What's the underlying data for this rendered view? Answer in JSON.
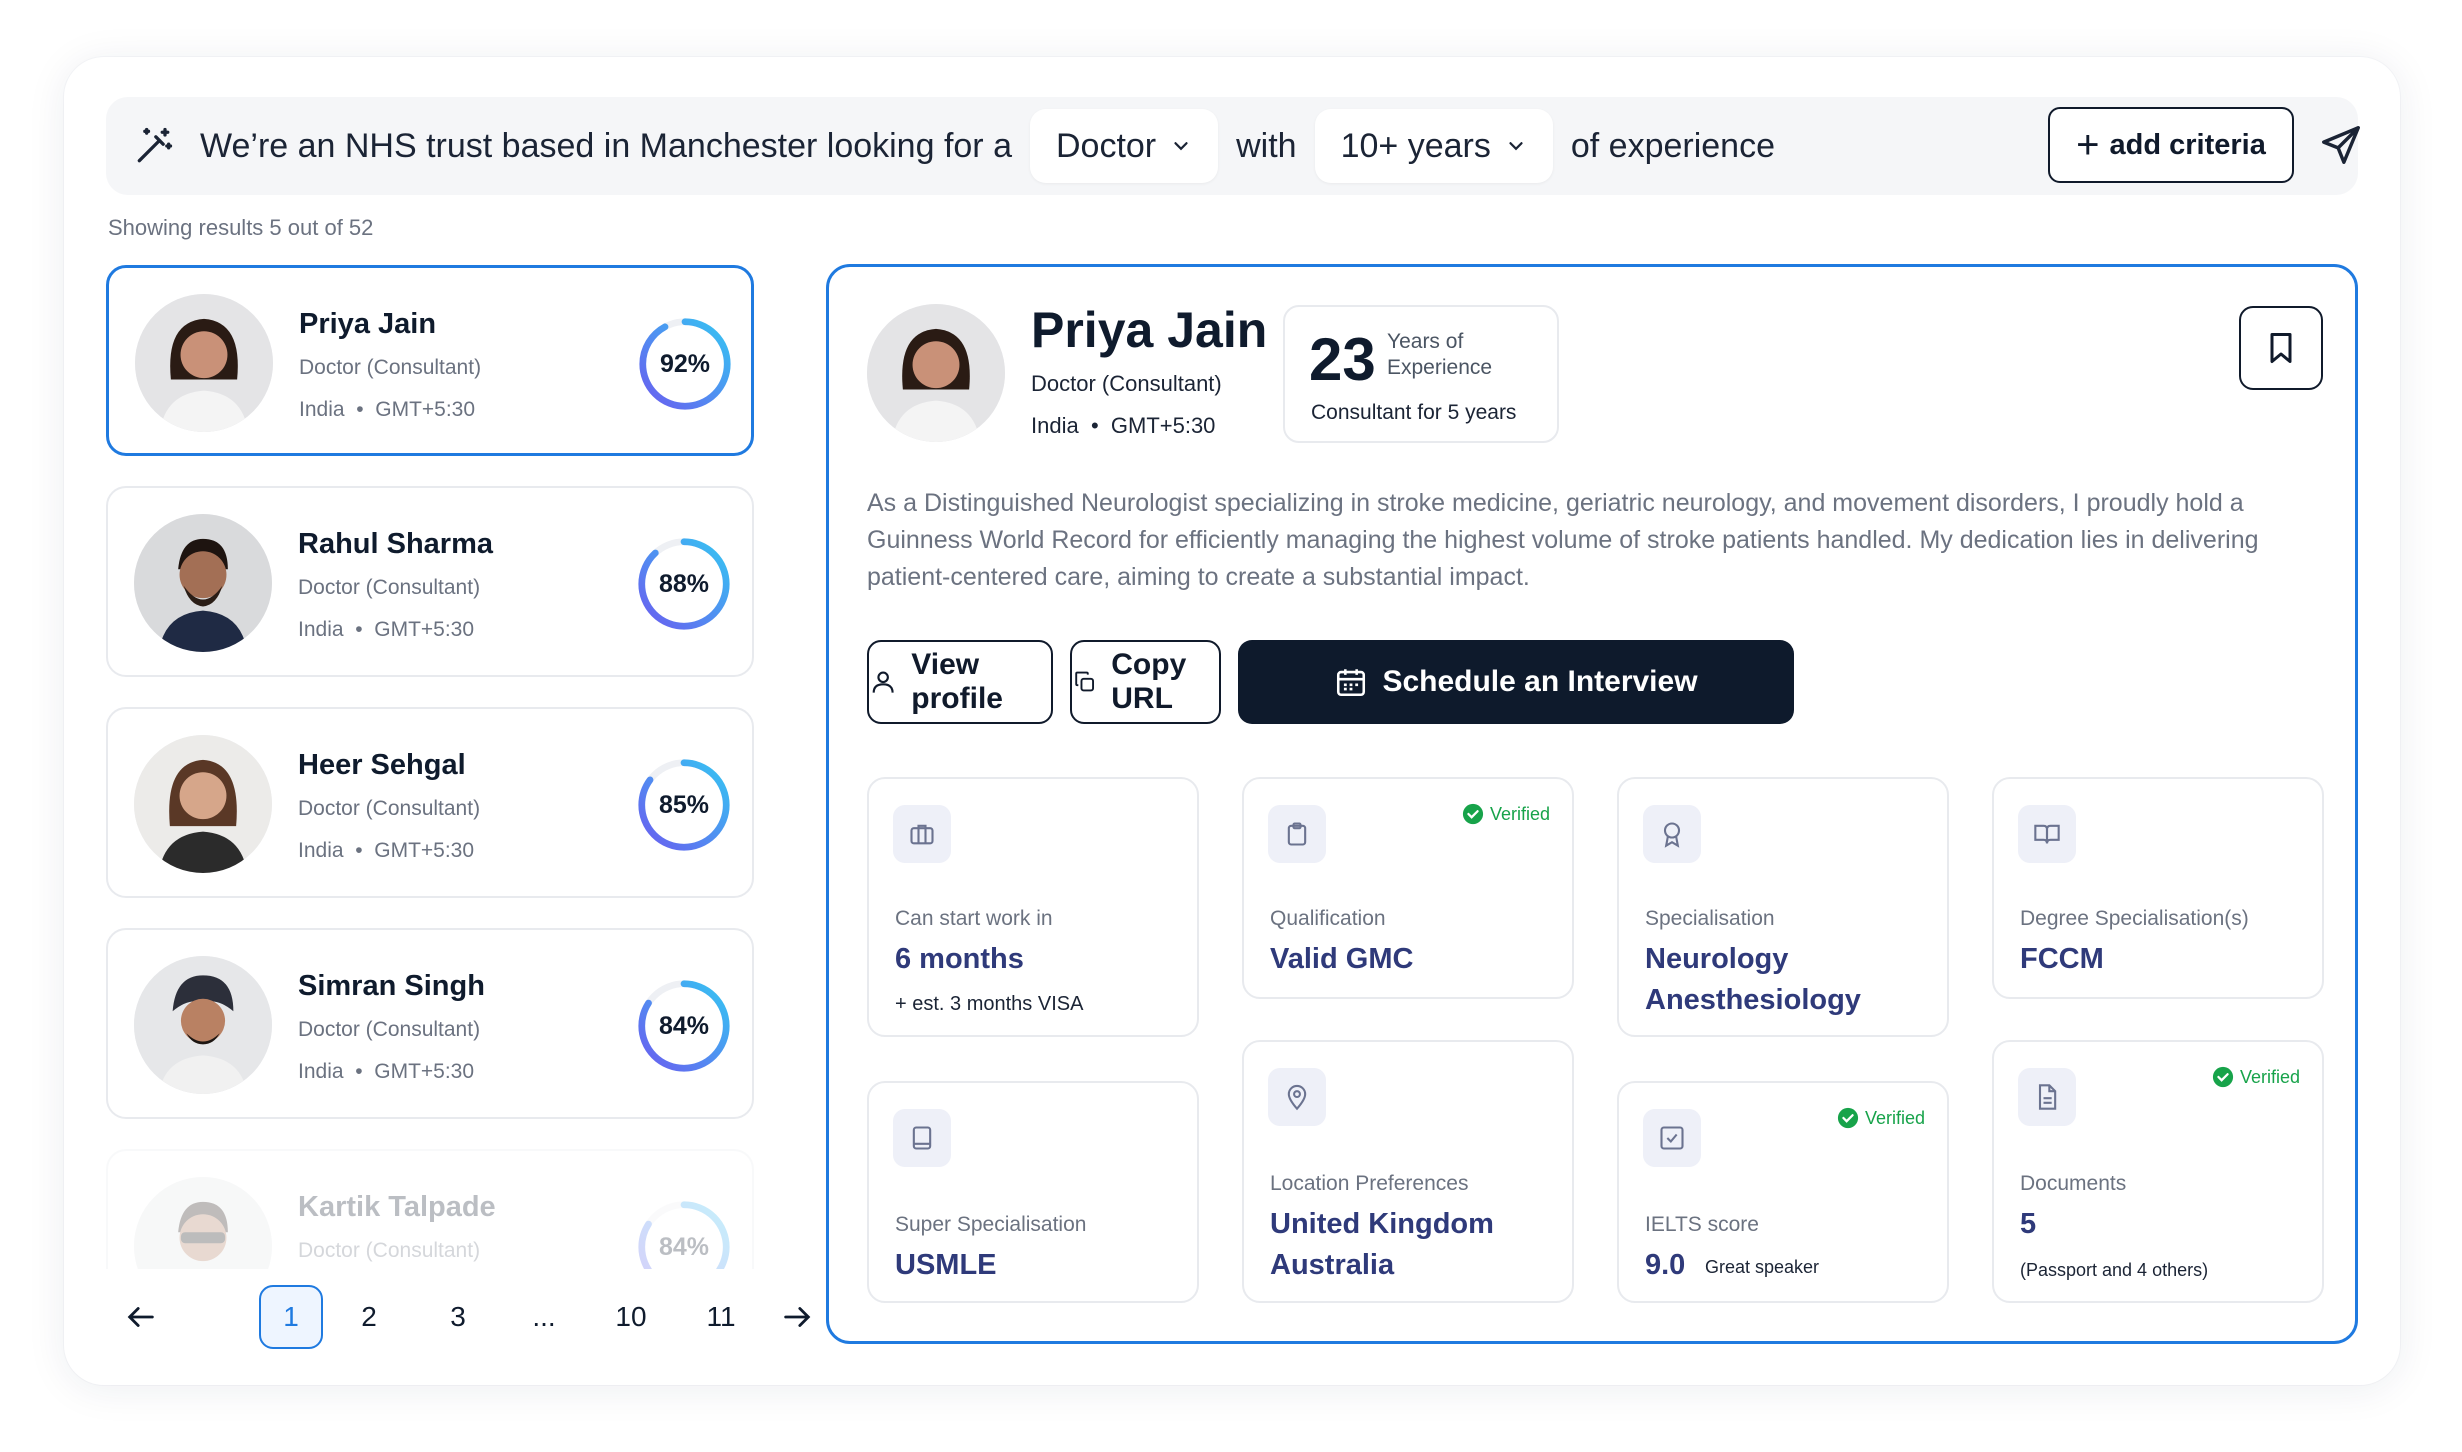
{
  "search": {
    "prefix": "We’re an NHS trust based in Manchester looking for a",
    "role_value": "Doctor",
    "connector": "with",
    "experience_value": "10+ years",
    "suffix": "of experience",
    "add_criteria_label": "add criteria"
  },
  "results": {
    "showing_text": "Showing results 5 out of 52"
  },
  "candidates": [
    {
      "name": "Priya Jain",
      "role": "Doctor (Consultant)",
      "country": "India",
      "tz": "GMT+5:30",
      "match": "92%",
      "match_value": 92,
      "avatar": "woman-avatar"
    },
    {
      "name": "Rahul Sharma",
      "role": "Doctor (Consultant)",
      "country": "India",
      "tz": "GMT+5:30",
      "match": "88%",
      "match_value": 88,
      "avatar": "man-avatar"
    },
    {
      "name": "Heer Sehgal",
      "role": "Doctor (Consultant)",
      "country": "India",
      "tz": "GMT+5:30",
      "match": "85%",
      "match_value": 85,
      "avatar": "woman-avatar"
    },
    {
      "name": "Simran Singh",
      "role": "Doctor (Consultant)",
      "country": "India",
      "tz": "GMT+5:30",
      "match": "84%",
      "match_value": 84,
      "avatar": "man-turban-avatar"
    },
    {
      "name": "Kartik Talpade",
      "role": "Doctor (Consultant)",
      "country": "India",
      "tz": "GMT+5:30",
      "match": "84%",
      "match_value": 84,
      "avatar": "man-sunglasses-avatar"
    }
  ],
  "pagination": {
    "pages": [
      "1",
      "2",
      "3",
      "...",
      "10",
      "11"
    ],
    "current": "1"
  },
  "detail": {
    "name": "Priya Jain",
    "role": "Doctor (Consultant)",
    "country": "India",
    "tz": "GMT+5:30",
    "years": "23",
    "years_label": "Years of Experience",
    "consultant_note": "Consultant for 5 years",
    "bio": "As a Distinguished Neurologist specializing in stroke medicine, geriatric neurology, and movement disorders, I proudly hold a Guinness World Record for efficiently managing the highest volume of stroke patients handled. My dedication lies in delivering patient-centered care, aiming to create a substantial impact.",
    "view_profile_label": "View profile",
    "copy_url_label": "Copy URL",
    "schedule_label": "Schedule an Interview",
    "verified_label": "Verified",
    "cards": {
      "start": {
        "label": "Can start work in",
        "value": "6 months",
        "note": "+ est. 3 months VISA",
        "icon": "briefcase-icon"
      },
      "qualification": {
        "label": "Qualification",
        "value": "Valid GMC",
        "icon": "clipboard-icon"
      },
      "specialisation": {
        "label": "Specialisation",
        "value1": "Neurology",
        "value2": "Anesthesiology",
        "icon": "award-icon"
      },
      "degree": {
        "label": "Degree Specialisation(s)",
        "value": "FCCM",
        "icon": "book-open-icon"
      },
      "super": {
        "label": "Super Specialisation",
        "value": "USMLE",
        "icon": "book-icon"
      },
      "location": {
        "label": "Location Preferences",
        "value1": "United Kingdom",
        "value2": "Australia",
        "icon": "map-pin-icon"
      },
      "ielts": {
        "label": "IELTS score",
        "value": "9.0",
        "note": "Great speaker",
        "icon": "check-square-icon"
      },
      "documents": {
        "label": "Documents",
        "value": "5",
        "note": "(Passport and 4 others)",
        "icon": "file-icon"
      }
    }
  },
  "colors": {
    "accent": "#1f7ae0",
    "dark": "#0e1a2c",
    "verified": "#17a34a",
    "value_text": "#2f3a7a"
  }
}
